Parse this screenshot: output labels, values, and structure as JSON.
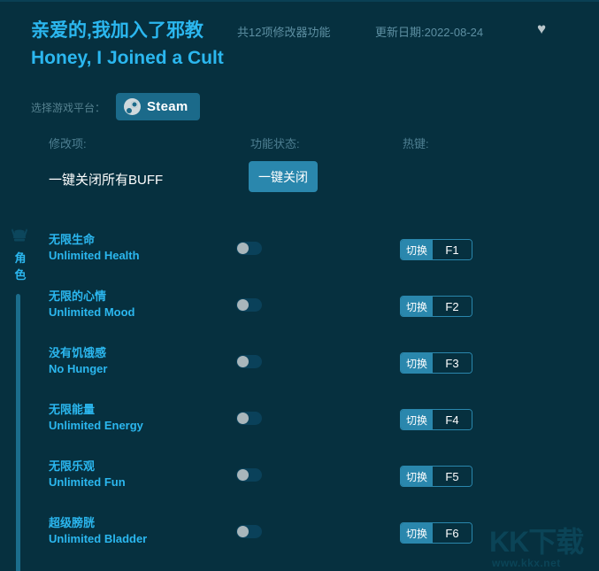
{
  "header": {
    "title_zh": "亲爱的,我加入了邪教",
    "title_en": "Honey, I Joined a Cult",
    "feature_count": "共12项修改器功能",
    "update_date": "更新日期:2022-08-24",
    "favorite_icon": "♥",
    "accent_color": "#2bb7ef",
    "background_color": "#06303f"
  },
  "platform": {
    "label": "选择游戏平台：",
    "selected": "Steam",
    "icon": "steam-icon"
  },
  "columns": {
    "item": "修改项:",
    "status": "功能状态:",
    "hotkey": "热键:"
  },
  "master": {
    "label": "一键关闭所有BUFF",
    "button": "一键关闭"
  },
  "category": {
    "icon": "helmet-icon",
    "label_chars": "角色"
  },
  "rows": [
    {
      "name_zh": "无限生命",
      "name_en": "Unlimited Health",
      "toggle_state": "off",
      "hotkey_action": "切换",
      "hotkey_key": "F1"
    },
    {
      "name_zh": "无限的心情",
      "name_en": "Unlimited Mood",
      "toggle_state": "off",
      "hotkey_action": "切换",
      "hotkey_key": "F2"
    },
    {
      "name_zh": "没有饥饿感",
      "name_en": "No Hunger",
      "toggle_state": "off",
      "hotkey_action": "切换",
      "hotkey_key": "F3"
    },
    {
      "name_zh": "无限能量",
      "name_en": "Unlimited Energy",
      "toggle_state": "off",
      "hotkey_action": "切换",
      "hotkey_key": "F4"
    },
    {
      "name_zh": "无限乐观",
      "name_en": "Unlimited Fun",
      "toggle_state": "off",
      "hotkey_action": "切换",
      "hotkey_key": "F5"
    },
    {
      "name_zh": "超级膀胱",
      "name_en": "Unlimited Bladder",
      "toggle_state": "off",
      "hotkey_action": "切换",
      "hotkey_key": "F6"
    }
  ],
  "watermark": {
    "main": "KK下载",
    "sub": "www.kkx.net"
  }
}
